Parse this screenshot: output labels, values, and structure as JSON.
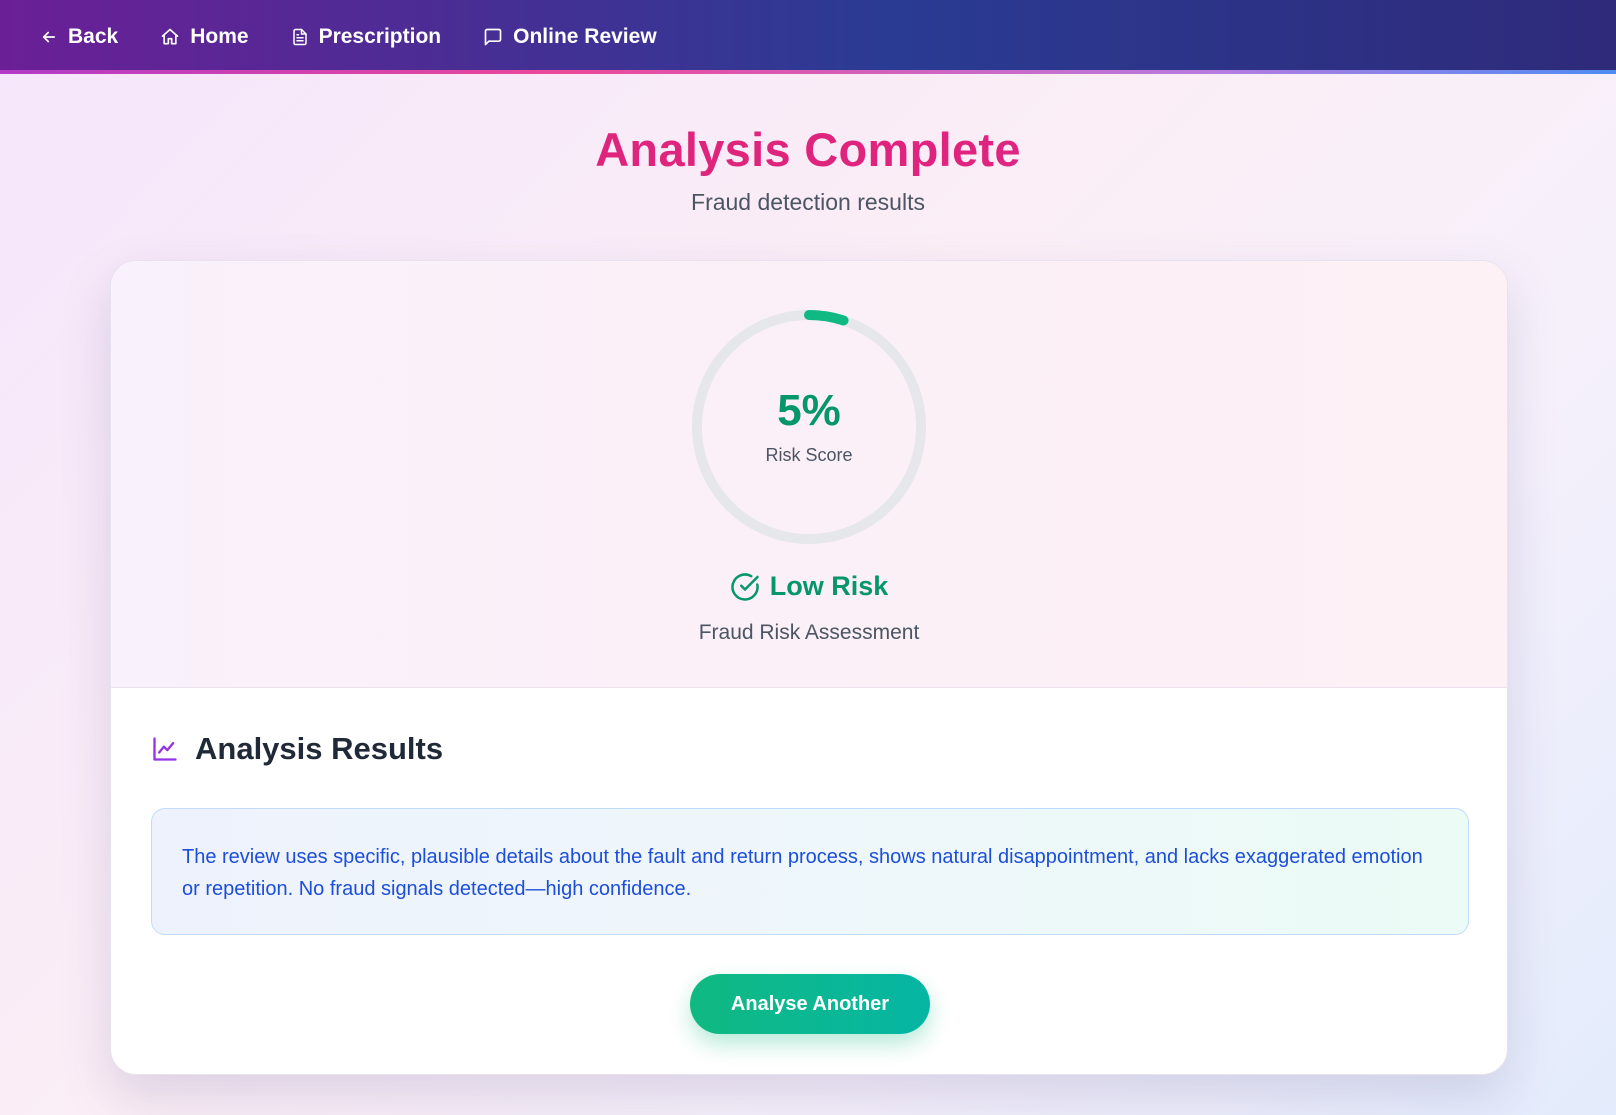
{
  "nav": {
    "back": "Back",
    "home": "Home",
    "prescription": "Prescription",
    "online_review": "Online Review"
  },
  "header": {
    "title": "Analysis Complete",
    "subtitle": "Fraud detection results"
  },
  "score": {
    "value": "5%",
    "fraction": 0.05,
    "label": "Risk Score",
    "level": "Low Risk",
    "assessment": "Fraud Risk Assessment"
  },
  "results": {
    "heading": "Analysis Results",
    "explanation": "The review uses specific, plausible details about the fault and return process, shows natural disappointment, and lacks exaggerated emotion or repetition. No fraud signals detected—high confidence."
  },
  "actions": {
    "analyse_another": "Analyse Another"
  },
  "colors": {
    "accent": "#db2777",
    "success": "#10b981",
    "info": "#1d4ed8"
  },
  "icons": [
    "arrow-left-icon",
    "home-icon",
    "document-icon",
    "message-icon",
    "check-circle-icon",
    "chart-line-icon"
  ]
}
